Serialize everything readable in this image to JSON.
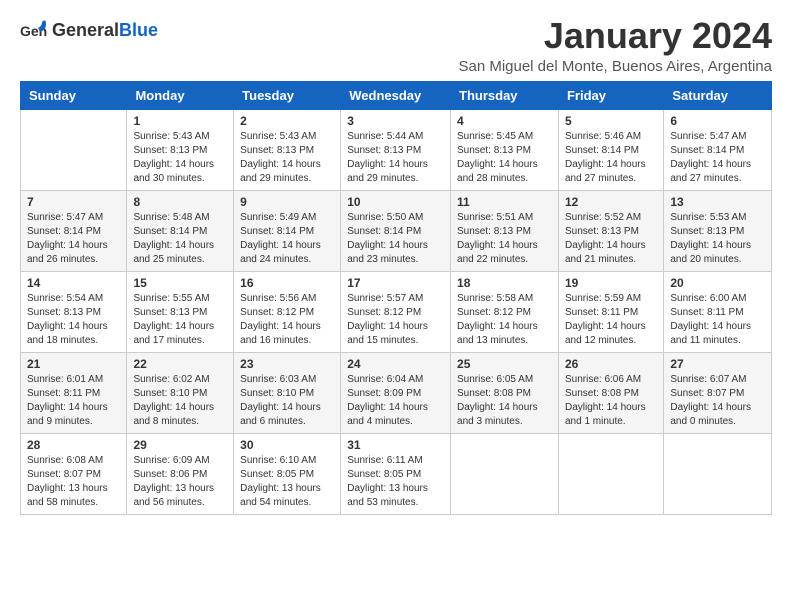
{
  "logo": {
    "general": "General",
    "blue": "Blue"
  },
  "header": {
    "month_title": "January 2024",
    "subtitle": "San Miguel del Monte, Buenos Aires, Argentina"
  },
  "weekdays": [
    "Sunday",
    "Monday",
    "Tuesday",
    "Wednesday",
    "Thursday",
    "Friday",
    "Saturday"
  ],
  "weeks": [
    [
      {
        "day": "",
        "info": ""
      },
      {
        "day": "1",
        "info": "Sunrise: 5:43 AM\nSunset: 8:13 PM\nDaylight: 14 hours\nand 30 minutes."
      },
      {
        "day": "2",
        "info": "Sunrise: 5:43 AM\nSunset: 8:13 PM\nDaylight: 14 hours\nand 29 minutes."
      },
      {
        "day": "3",
        "info": "Sunrise: 5:44 AM\nSunset: 8:13 PM\nDaylight: 14 hours\nand 29 minutes."
      },
      {
        "day": "4",
        "info": "Sunrise: 5:45 AM\nSunset: 8:13 PM\nDaylight: 14 hours\nand 28 minutes."
      },
      {
        "day": "5",
        "info": "Sunrise: 5:46 AM\nSunset: 8:14 PM\nDaylight: 14 hours\nand 27 minutes."
      },
      {
        "day": "6",
        "info": "Sunrise: 5:47 AM\nSunset: 8:14 PM\nDaylight: 14 hours\nand 27 minutes."
      }
    ],
    [
      {
        "day": "7",
        "info": "Sunrise: 5:47 AM\nSunset: 8:14 PM\nDaylight: 14 hours\nand 26 minutes."
      },
      {
        "day": "8",
        "info": "Sunrise: 5:48 AM\nSunset: 8:14 PM\nDaylight: 14 hours\nand 25 minutes."
      },
      {
        "day": "9",
        "info": "Sunrise: 5:49 AM\nSunset: 8:14 PM\nDaylight: 14 hours\nand 24 minutes."
      },
      {
        "day": "10",
        "info": "Sunrise: 5:50 AM\nSunset: 8:14 PM\nDaylight: 14 hours\nand 23 minutes."
      },
      {
        "day": "11",
        "info": "Sunrise: 5:51 AM\nSunset: 8:13 PM\nDaylight: 14 hours\nand 22 minutes."
      },
      {
        "day": "12",
        "info": "Sunrise: 5:52 AM\nSunset: 8:13 PM\nDaylight: 14 hours\nand 21 minutes."
      },
      {
        "day": "13",
        "info": "Sunrise: 5:53 AM\nSunset: 8:13 PM\nDaylight: 14 hours\nand 20 minutes."
      }
    ],
    [
      {
        "day": "14",
        "info": "Sunrise: 5:54 AM\nSunset: 8:13 PM\nDaylight: 14 hours\nand 18 minutes."
      },
      {
        "day": "15",
        "info": "Sunrise: 5:55 AM\nSunset: 8:13 PM\nDaylight: 14 hours\nand 17 minutes."
      },
      {
        "day": "16",
        "info": "Sunrise: 5:56 AM\nSunset: 8:12 PM\nDaylight: 14 hours\nand 16 minutes."
      },
      {
        "day": "17",
        "info": "Sunrise: 5:57 AM\nSunset: 8:12 PM\nDaylight: 14 hours\nand 15 minutes."
      },
      {
        "day": "18",
        "info": "Sunrise: 5:58 AM\nSunset: 8:12 PM\nDaylight: 14 hours\nand 13 minutes."
      },
      {
        "day": "19",
        "info": "Sunrise: 5:59 AM\nSunset: 8:11 PM\nDaylight: 14 hours\nand 12 minutes."
      },
      {
        "day": "20",
        "info": "Sunrise: 6:00 AM\nSunset: 8:11 PM\nDaylight: 14 hours\nand 11 minutes."
      }
    ],
    [
      {
        "day": "21",
        "info": "Sunrise: 6:01 AM\nSunset: 8:11 PM\nDaylight: 14 hours\nand 9 minutes."
      },
      {
        "day": "22",
        "info": "Sunrise: 6:02 AM\nSunset: 8:10 PM\nDaylight: 14 hours\nand 8 minutes."
      },
      {
        "day": "23",
        "info": "Sunrise: 6:03 AM\nSunset: 8:10 PM\nDaylight: 14 hours\nand 6 minutes."
      },
      {
        "day": "24",
        "info": "Sunrise: 6:04 AM\nSunset: 8:09 PM\nDaylight: 14 hours\nand 4 minutes."
      },
      {
        "day": "25",
        "info": "Sunrise: 6:05 AM\nSunset: 8:08 PM\nDaylight: 14 hours\nand 3 minutes."
      },
      {
        "day": "26",
        "info": "Sunrise: 6:06 AM\nSunset: 8:08 PM\nDaylight: 14 hours\nand 1 minute."
      },
      {
        "day": "27",
        "info": "Sunrise: 6:07 AM\nSunset: 8:07 PM\nDaylight: 14 hours\nand 0 minutes."
      }
    ],
    [
      {
        "day": "28",
        "info": "Sunrise: 6:08 AM\nSunset: 8:07 PM\nDaylight: 13 hours\nand 58 minutes."
      },
      {
        "day": "29",
        "info": "Sunrise: 6:09 AM\nSunset: 8:06 PM\nDaylight: 13 hours\nand 56 minutes."
      },
      {
        "day": "30",
        "info": "Sunrise: 6:10 AM\nSunset: 8:05 PM\nDaylight: 13 hours\nand 54 minutes."
      },
      {
        "day": "31",
        "info": "Sunrise: 6:11 AM\nSunset: 8:05 PM\nDaylight: 13 hours\nand 53 minutes."
      },
      {
        "day": "",
        "info": ""
      },
      {
        "day": "",
        "info": ""
      },
      {
        "day": "",
        "info": ""
      }
    ]
  ]
}
